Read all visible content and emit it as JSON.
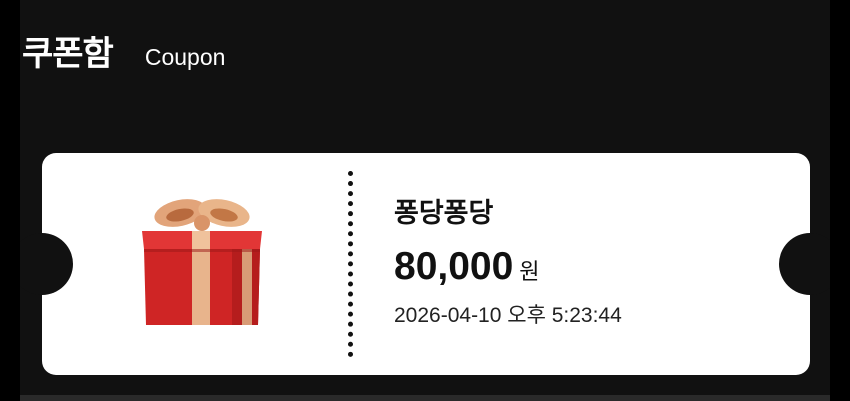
{
  "header": {
    "title": "쿠폰함",
    "subtitle": "Coupon"
  },
  "coupon": {
    "icon": "gift-icon",
    "name": "퐁당퐁당",
    "amount": "80,000",
    "unit": "원",
    "issued_at": "2026-04-10 오후 5:23:44"
  },
  "colors": {
    "background": "#111111",
    "card": "#ffffff",
    "gift_box": "#d32a2a",
    "ribbon": "#e8b48c"
  }
}
